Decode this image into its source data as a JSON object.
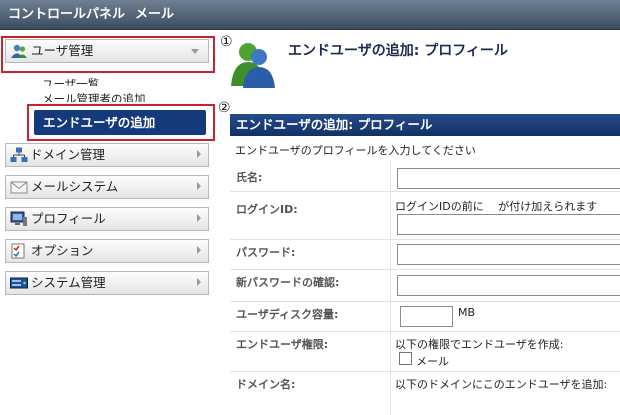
{
  "topbar": {
    "menu_control_panel": "コントロールパネル",
    "menu_mail": "メール"
  },
  "sidebar": {
    "items": [
      {
        "label": "ユーザ管理",
        "icon": "users-icon"
      },
      {
        "label": "ドメイン管理",
        "icon": "network-icon"
      },
      {
        "label": "メールシステム",
        "icon": "envelope-icon"
      },
      {
        "label": "プロフィール",
        "icon": "monitor-icon"
      },
      {
        "label": "オプション",
        "icon": "checklist-icon"
      },
      {
        "label": "システム管理",
        "icon": "server-icon"
      }
    ],
    "sub_items": [
      "ユーザ一覧",
      "メール管理者の追加",
      "エンドユーザの追加"
    ]
  },
  "callouts": [
    "①",
    "②"
  ],
  "main": {
    "title": "エンドユーザの追加: プロフィール",
    "section_header": "エンドユーザの追加: プロフィール",
    "description": "エンドユーザのプロフィールを入力してください",
    "fields": [
      {
        "label": "氏名:"
      },
      {
        "label": "ログインID:",
        "note": "ログインIDの前に　 が付け加えられます"
      },
      {
        "label": "パスワード:"
      },
      {
        "label": "新パスワードの確認:"
      },
      {
        "label": "ユーザディスク容量:",
        "unit": "MB"
      },
      {
        "label": "エンドユーザ権限:",
        "note": "以下の権限でエンドユーザを作成:",
        "checkbox_label": "メール"
      },
      {
        "label": "ドメイン名:",
        "note": "以下のドメインにこのエンドユーザを追加:"
      }
    ]
  },
  "colors": {
    "accent_red": "#c8232c",
    "nav_blue": "#153a7b",
    "header_blue": "#1c3f7a"
  }
}
